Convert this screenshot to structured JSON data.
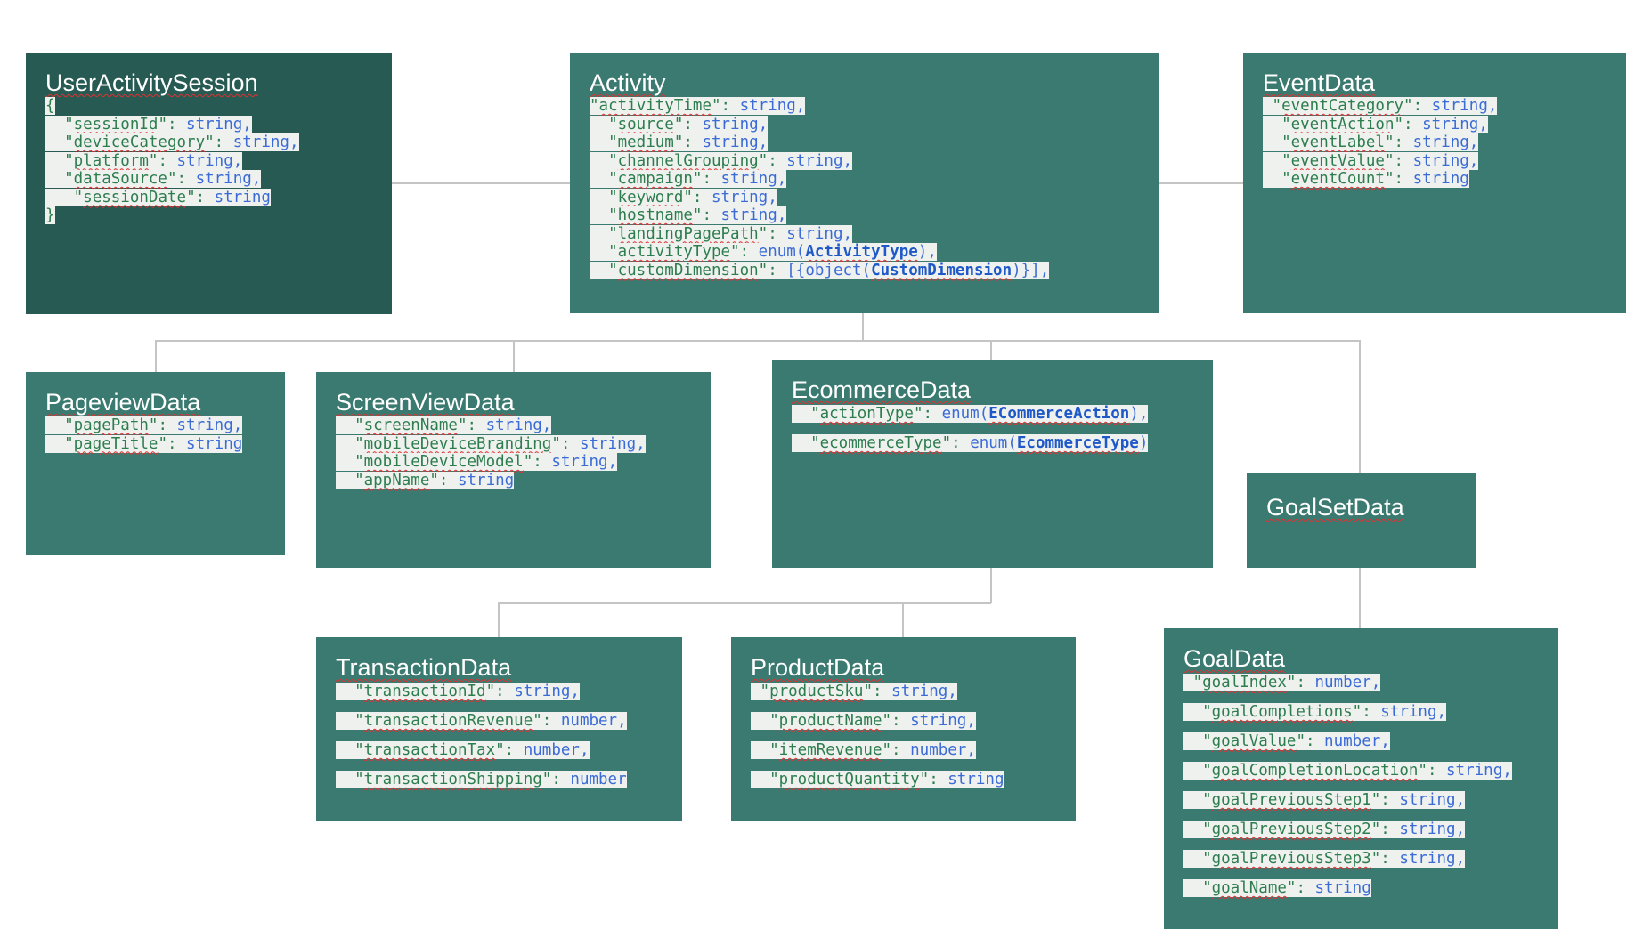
{
  "boxes": [
    {
      "id": "user-activity-session",
      "title": "UserActivitySession",
      "dark": true,
      "open": "{",
      "close": "}",
      "fields": [
        {
          "indent": "  ",
          "key": "sessionId",
          "type": "string",
          "trail": ","
        },
        {
          "indent": "  ",
          "key": "deviceCategory",
          "type": "string",
          "trail": ","
        },
        {
          "indent": "  ",
          "key": "platform",
          "type": "string",
          "trail": ","
        },
        {
          "indent": "  ",
          "key": "dataSource",
          "type": "string",
          "trail": ","
        },
        {
          "indent": "   ",
          "key": "sessionDate",
          "type": "string",
          "trail": ""
        }
      ]
    },
    {
      "id": "activity",
      "title": "Activity",
      "fields": [
        {
          "indent": "",
          "key": "activityTime",
          "type": "string",
          "trail": ","
        },
        {
          "indent": "  ",
          "key": "source",
          "type": "string",
          "trail": ","
        },
        {
          "indent": "  ",
          "key": "medium",
          "type": "string",
          "trail": ","
        },
        {
          "indent": "  ",
          "key": "channelGrouping",
          "type": "string",
          "trail": ","
        },
        {
          "indent": "  ",
          "key": "campaign",
          "type": "string",
          "trail": ","
        },
        {
          "indent": "  ",
          "key": "keyword",
          "type": "string",
          "trail": ","
        },
        {
          "indent": "  ",
          "key": "hostname",
          "type": "string",
          "trail": ","
        },
        {
          "indent": "  ",
          "key": "landingPagePath",
          "type": "string",
          "trail": ","
        },
        {
          "indent": "  ",
          "key": "activityType",
          "type": "enum(",
          "ref": "ActivityType",
          "after": ")",
          "trail": ","
        },
        {
          "indent": "  ",
          "key": "customDimension",
          "type": "[{object(",
          "ref": "CustomDimension",
          "after": ")}]",
          "trail": ","
        }
      ]
    },
    {
      "id": "event-data",
      "title": "EventData",
      "fields": [
        {
          "indent": " ",
          "key": "eventCategory",
          "type": "string",
          "trail": ","
        },
        {
          "indent": "  ",
          "key": "eventAction",
          "type": "string",
          "trail": ","
        },
        {
          "indent": "  ",
          "key": "eventLabel",
          "type": "string",
          "trail": ","
        },
        {
          "indent": "  ",
          "key": "eventValue",
          "type": "string",
          "trail": ","
        },
        {
          "indent": "  ",
          "key": "eventCount",
          "type": "string",
          "trail": ""
        }
      ]
    },
    {
      "id": "pageview-data",
      "title": "PageviewData",
      "fields": [
        {
          "indent": "  ",
          "key": "pagePath",
          "type": "string",
          "trail": ","
        },
        {
          "indent": "  ",
          "key": "pageTitle",
          "type": "string",
          "trail": ""
        }
      ]
    },
    {
      "id": "screen-view-data",
      "title": "ScreenViewData",
      "fields": [
        {
          "indent": "  ",
          "key": "screenName",
          "type": "string",
          "trail": ","
        },
        {
          "indent": "  ",
          "key": "mobileDeviceBranding",
          "type": "string",
          "trail": ","
        },
        {
          "indent": "  ",
          "key": "mobileDeviceModel",
          "type": "string",
          "trail": ","
        },
        {
          "indent": "  ",
          "key": "appName",
          "type": "string",
          "trail": ""
        }
      ]
    },
    {
      "id": "ecommerce-data",
      "title": "EcommerceData",
      "spaced": true,
      "fields": [
        {
          "indent": "  ",
          "key": "actionType",
          "type": "enum(",
          "ref": "ECommerceAction",
          "after": ")",
          "trail": ","
        },
        {
          "indent": "  ",
          "key": "ecommerceType",
          "type": "enum(",
          "ref": "EcommerceType",
          "after": ")",
          "trail": ""
        }
      ]
    },
    {
      "id": "goal-set-data",
      "title": "GoalSetData",
      "fields": []
    },
    {
      "id": "transaction-data",
      "title": "TransactionData",
      "spaced": true,
      "fields": [
        {
          "indent": "  ",
          "key": "transactionId",
          "type": "string",
          "trail": ","
        },
        {
          "indent": "  ",
          "key": "transactionRevenue",
          "type": "number",
          "trail": ","
        },
        {
          "indent": "  ",
          "key": "transactionTax",
          "type": "number",
          "trail": ","
        },
        {
          "indent": "  ",
          "key": "transactionShipping",
          "type": "number",
          "trail": ""
        }
      ]
    },
    {
      "id": "product-data",
      "title": "ProductData",
      "spaced": true,
      "fields": [
        {
          "indent": " ",
          "key": "productSku",
          "type": "string",
          "trail": ","
        },
        {
          "indent": "  ",
          "key": "productName",
          "type": "string",
          "trail": ","
        },
        {
          "indent": "  ",
          "key": "itemRevenue",
          "type": "number",
          "trail": ","
        },
        {
          "indent": "  ",
          "key": "productQuantity",
          "type": "string",
          "trail": ""
        }
      ]
    },
    {
      "id": "goal-data",
      "title": "GoalData",
      "spaced": true,
      "fields": [
        {
          "indent": " ",
          "key": "goalIndex",
          "type": "number",
          "trail": ","
        },
        {
          "indent": "  ",
          "key": "goalCompletions",
          "type": "string",
          "trail": ","
        },
        {
          "indent": "  ",
          "key": "goalValue",
          "type": "number",
          "trail": ","
        },
        {
          "indent": "  ",
          "key": "goalCompletionLocation",
          "type": "string",
          "trail": ","
        },
        {
          "indent": "  ",
          "key": "goalPreviousStep1",
          "type": "string",
          "trail": ","
        },
        {
          "indent": "  ",
          "key": "goalPreviousStep2",
          "type": "string",
          "trail": ","
        },
        {
          "indent": "  ",
          "key": "goalPreviousStep3",
          "type": "string",
          "trail": ","
        },
        {
          "indent": "  ",
          "key": "goalName",
          "type": "string",
          "trail": ""
        }
      ]
    }
  ],
  "connectors": [
    {
      "from": "user-activity-session",
      "to": "activity"
    },
    {
      "from": "activity",
      "to": "event-data"
    },
    {
      "from": "activity",
      "to": "pageview-data"
    },
    {
      "from": "activity",
      "to": "screen-view-data"
    },
    {
      "from": "activity",
      "to": "ecommerce-data"
    },
    {
      "from": "activity",
      "to": "goal-set-data"
    },
    {
      "from": "ecommerce-data",
      "to": "transaction-data"
    },
    {
      "from": "ecommerce-data",
      "to": "product-data"
    },
    {
      "from": "goal-set-data",
      "to": "goal-data"
    }
  ],
  "colors": {
    "box": "#3b7a70",
    "box_dark": "#275a52",
    "connector": "#c4c4c4",
    "key": "#2e7d4f",
    "type": "#3b6bd6",
    "ref": "#1f58c8"
  }
}
